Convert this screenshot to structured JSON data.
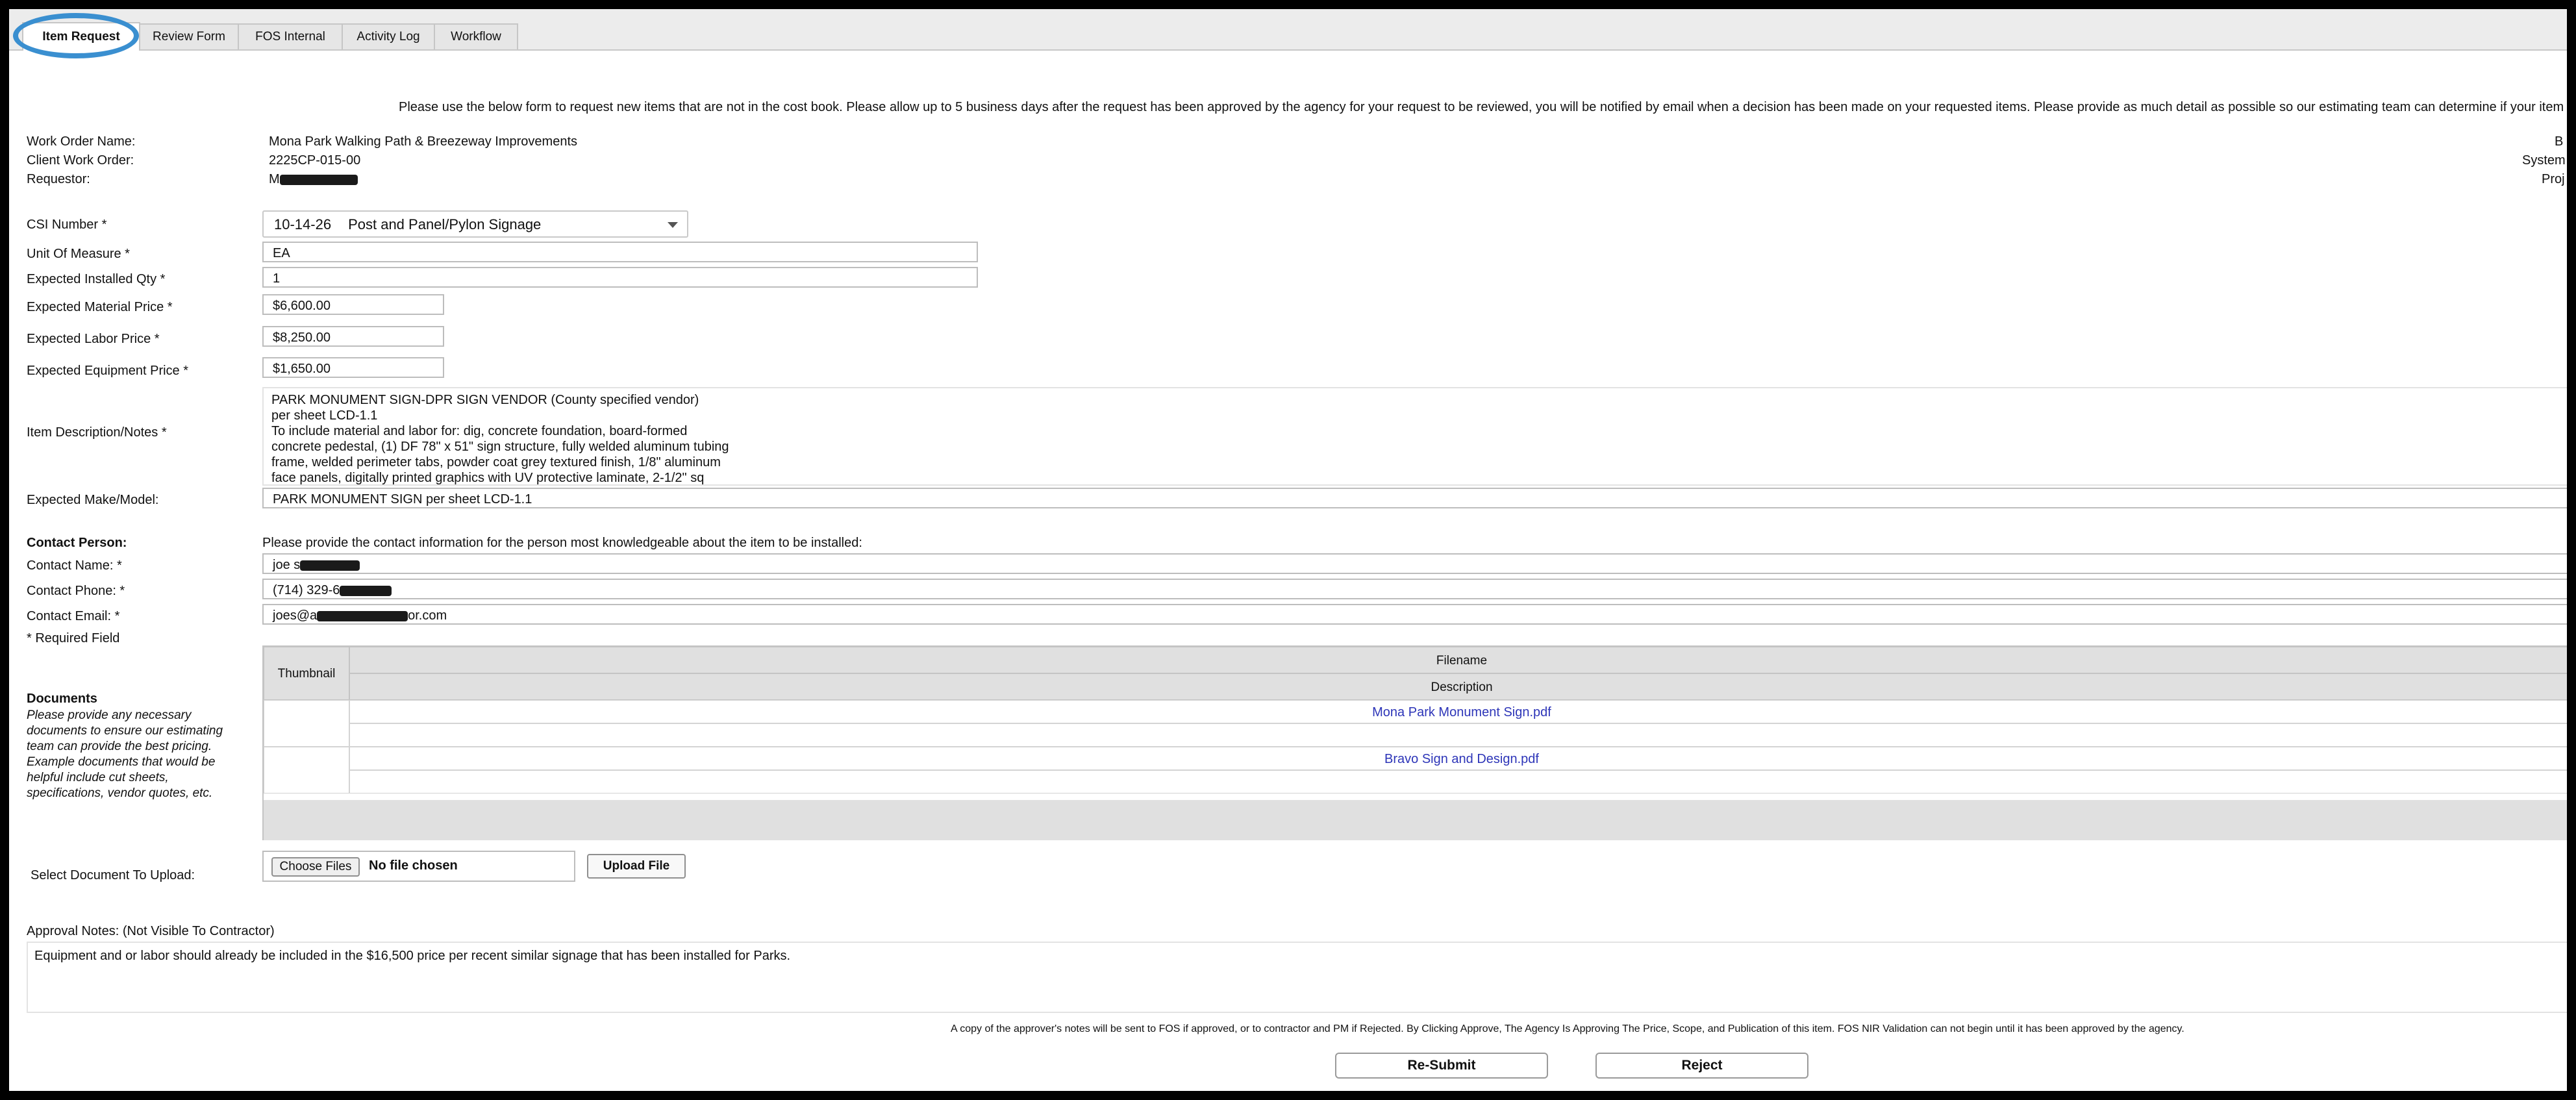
{
  "tabs": [
    {
      "label": "Item Request",
      "active": true
    },
    {
      "label": "Review Form"
    },
    {
      "label": "FOS Internal"
    },
    {
      "label": "Activity Log"
    },
    {
      "label": "Workflow"
    }
  ],
  "intro_text": "Please use the below form to request new items that are not in the cost book.  Please allow up to 5 business days after the request has been approved by the agency for your request to be reviewed, you will be notified by email when a decision has been made on your requested items.  Please provide as much detail as possible so our estimating team can determine if your item is el",
  "work_order": {
    "name_label": "Work Order Name:",
    "name_value": "Mona Park Walking Path & Breezeway Improvements",
    "client_label": "Client Work Order:",
    "client_value": "2225CP-015-00",
    "requestor_label": "Requestor:",
    "requestor_value": "M"
  },
  "right_labels": {
    "b": "B",
    "system": "System",
    "proj": "Proj"
  },
  "csi": {
    "label": "CSI Number *",
    "code": "10-14-26",
    "name": "Post and Panel/Pylon Signage"
  },
  "uom": {
    "label": "Unit Of Measure *",
    "value": "EA"
  },
  "qty": {
    "label": "Expected Installed Qty *",
    "value": "1"
  },
  "material": {
    "label": "Expected Material Price *",
    "value": "$6,600.00"
  },
  "labor": {
    "label": "Expected Labor Price *",
    "value": "$8,250.00"
  },
  "equipment": {
    "label": "Expected Equipment Price *",
    "value": "$1,650.00"
  },
  "description": {
    "label": "Item Description/Notes *",
    "lines": [
      "PARK MONUMENT SIGN-DPR SIGN VENDOR (County specified vendor)",
      "per sheet LCD-1.1",
      "To include material and labor for: dig, concrete foundation, board-formed",
      "concrete pedestal, (1) DF 78\" x 51\" sign structure, fully welded aluminum tubing",
      "frame, welded perimeter tabs, powder coat grey textured finish, 1/8\" aluminum",
      "face panels, digitally printed graphics with UV protective laminate, 2-1/2\" sq"
    ]
  },
  "make_model": {
    "label": "Expected Make/Model:",
    "value": "PARK MONUMENT SIGN per sheet LCD-1.1"
  },
  "contact": {
    "heading": "Contact Person:",
    "prompt": "Please provide the contact information for the person most knowledgeable about the item to be installed:",
    "name_label": "Contact Name: *",
    "name_value": "joe s",
    "phone_label": "Contact Phone: *",
    "phone_value": "(714) 329-6",
    "email_label": "Contact Email: *",
    "email_prefix": "joes@a",
    "email_suffix": "or.com",
    "required_note": "* Required Field"
  },
  "documents": {
    "heading": "Documents",
    "help": [
      "Please provide any necessary",
      "documents to ensure our estimating",
      "team can provide the best pricing.",
      "Example documents that would be",
      "helpful include cut sheets,",
      "specifications, vendor quotes, etc."
    ],
    "col_thumbnail": "Thumbnail",
    "col_filename": "Filename",
    "col_description": "Description",
    "files": [
      "Mona Park Monument Sign.pdf",
      "Bravo Sign and Design.pdf"
    ]
  },
  "upload": {
    "label": "Select Document To Upload:",
    "choose_label": "Choose Files",
    "no_file": "No file chosen",
    "upload_label": "Upload File"
  },
  "approval": {
    "label": "Approval Notes: (Not Visible To Contractor)",
    "value": "Equipment and or labor should already be included in the $16,500 price per recent similar signage that has been installed for Parks."
  },
  "footer_note": "A copy of the approver's notes will be sent to FOS if approved, or to contractor and PM if Rejected. By Clicking Approve, The Agency Is Approving The Price, Scope, and Publication of this item. FOS NIR Validation can not begin until it has been approved by the agency.",
  "buttons": {
    "resubmit": "Re-Submit",
    "reject": "Reject"
  },
  "colors": {
    "highlight_ring": "#3a8fd0",
    "link": "#2d35b8"
  }
}
